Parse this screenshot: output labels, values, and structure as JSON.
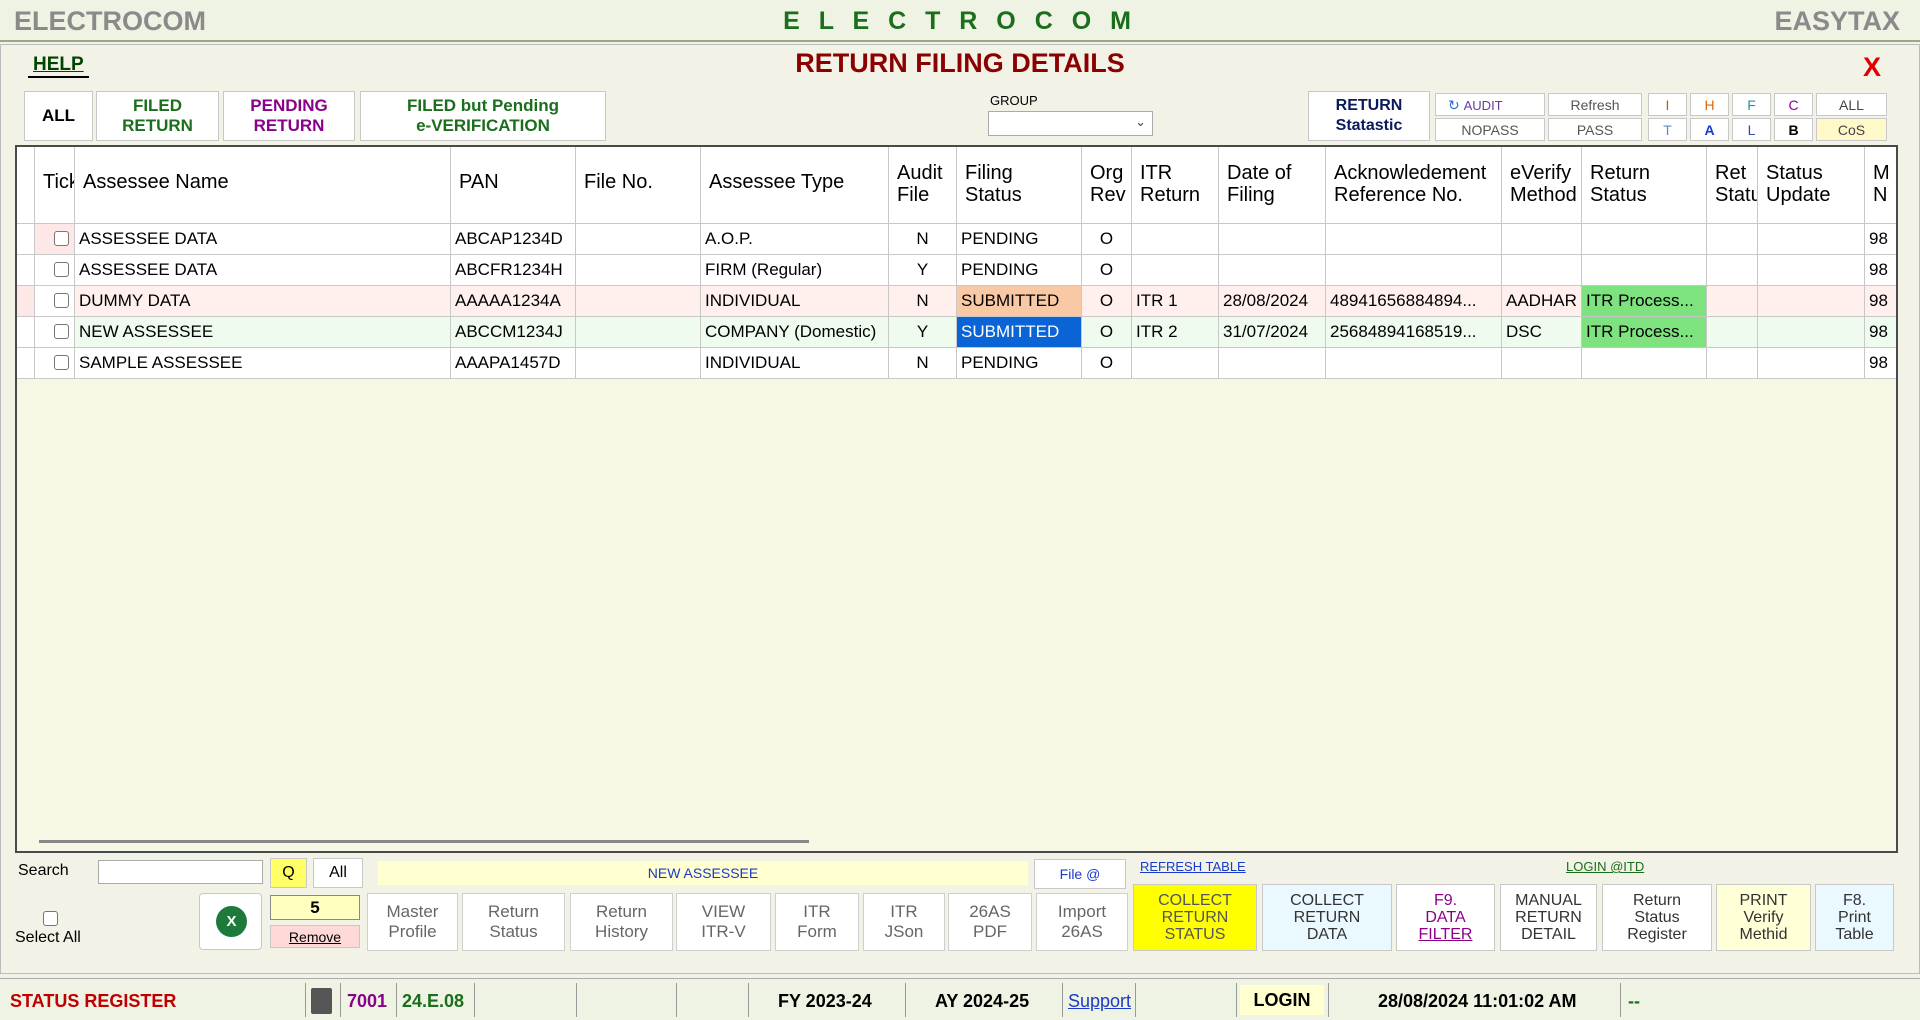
{
  "app": {
    "left_title": "ELECTROCOM",
    "center_title": "E L E C T R O C O M",
    "right_title": "EASYTAX"
  },
  "header": {
    "help": "HELP",
    "title": "RETURN FILING DETAILS",
    "close": "X"
  },
  "tabs": {
    "all": "ALL",
    "filed_1": "FILED",
    "filed_2": "RETURN",
    "pending_1": "PENDING",
    "pending_2": "RETURN",
    "fbp_1": "FILED but  Pending",
    "fbp_2": "e-VERIFICATION"
  },
  "group": {
    "label": "GROUP",
    "value": ""
  },
  "stats": {
    "return_1": "RETURN",
    "return_2": "Statastic",
    "audit": "AUDIT",
    "nopass": "NOPASS",
    "refresh": "Refresh",
    "pass": "PASS",
    "i": "I",
    "h": "H",
    "f": "F",
    "c": "C",
    "all": "ALL",
    "t": "T",
    "a": "A",
    "l": "L",
    "b": "B",
    "cos": "CoS"
  },
  "table": {
    "headers": [
      "Tick",
      "Assessee Name",
      "PAN",
      "File No.",
      "Assessee Type",
      "Audit File",
      "Filing Status",
      "Org Rev",
      "ITR Return",
      "Date of Filing",
      "Acknowledement Reference No.",
      "eVerify Method",
      "Return Status",
      "Ret Statu",
      "Status Update",
      "M N"
    ],
    "headers_l1": [
      "Tick",
      "Assessee Name",
      "PAN",
      "File No.",
      "Assessee Type",
      "Audit",
      "Filing",
      "Org",
      "ITR",
      "Date of",
      "Acknowledement",
      "eVerify",
      "Return",
      "Ret",
      "Status",
      "M"
    ],
    "headers_l2": [
      "",
      "",
      "",
      "",
      "",
      "File",
      "Status",
      "Rev",
      "Return",
      "Filing",
      "Reference No.",
      "Method",
      "Status",
      "Statu",
      "Update",
      "N"
    ],
    "rows": [
      {
        "name": "ASSESSEE DATA",
        "pan": "ABCAP1234D",
        "file": "",
        "type": "A.O.P.",
        "audit": "N",
        "status": "PENDING",
        "org": "O",
        "itr": "",
        "date": "",
        "ack": "",
        "everify": "",
        "rstatus": "",
        "ret": "",
        "update": "",
        "m": "98"
      },
      {
        "name": "ASSESSEE DATA",
        "pan": "ABCFR1234H",
        "file": "",
        "type": "FIRM (Regular)",
        "audit": "Y",
        "status": "PENDING",
        "org": "O",
        "itr": "",
        "date": "",
        "ack": "",
        "everify": "",
        "rstatus": "",
        "ret": "",
        "update": "",
        "m": "98"
      },
      {
        "name": "DUMMY DATA",
        "pan": "AAAAA1234A",
        "file": "",
        "type": "INDIVIDUAL",
        "audit": "N",
        "status": "SUBMITTED",
        "org": "O",
        "itr": "ITR 1",
        "date": "28/08/2024",
        "ack": "48941656884894...",
        "everify": "AADHAR",
        "rstatus": "ITR Process...",
        "ret": "",
        "update": "",
        "m": "98"
      },
      {
        "name": "NEW ASSESSEE",
        "pan": "ABCCM1234J",
        "file": "",
        "type": "COMPANY (Domestic)",
        "audit": "Y",
        "status": "SUBMITTED",
        "org": "O",
        "itr": "ITR 2",
        "date": "31/07/2024",
        "ack": "25684894168519...",
        "everify": "DSC",
        "rstatus": "ITR Process...",
        "ret": "",
        "update": "",
        "m": "98"
      },
      {
        "name": "SAMPLE ASSESSEE",
        "pan": "AAAPA1457D",
        "file": "",
        "type": "INDIVIDUAL",
        "audit": "N",
        "status": "PENDING",
        "org": "O",
        "itr": "",
        "date": "",
        "ack": "",
        "everify": "",
        "rstatus": "",
        "ret": "",
        "update": "",
        "m": "98"
      }
    ]
  },
  "bottom": {
    "search_label": "Search",
    "search_value": "",
    "q": "Q",
    "all": "All",
    "current": "NEW ASSESSEE",
    "file_at": "File @",
    "refresh_table": "REFRESH TABLE",
    "login_itd": "LOGIN @ITD",
    "select_all": "Select All",
    "count": "5",
    "remove": "Remove",
    "buttons": [
      {
        "l1": "Master",
        "l2": "Profile"
      },
      {
        "l1": "Return",
        "l2": "Status"
      },
      {
        "l1": "Return",
        "l2": "History"
      },
      {
        "l1": "VIEW",
        "l2": "ITR-V"
      },
      {
        "l1": "ITR",
        "l2": "Form"
      },
      {
        "l1": "ITR",
        "l2": "JSon"
      },
      {
        "l1": "26AS",
        "l2": "PDF"
      },
      {
        "l1": "Import",
        "l2": "26AS"
      }
    ],
    "collect_status": [
      "COLLECT",
      "RETURN",
      "STATUS"
    ],
    "collect_data": [
      "COLLECT",
      "RETURN",
      "DATA"
    ],
    "f9": [
      "F9.",
      "DATA",
      "FILTER"
    ],
    "manual": [
      "MANUAL",
      "RETURN",
      "DETAIL"
    ],
    "register": [
      "Return",
      "Status",
      "Register"
    ],
    "print_verify": [
      "PRINT",
      "Verify",
      "Methid"
    ],
    "f8": [
      "F8.",
      "Print",
      "Table"
    ]
  },
  "status": {
    "title": "STATUS REGISTER",
    "code": "7001",
    "version": "24.E.08",
    "fy": "FY 2023-24",
    "ay": "AY 2024-25",
    "support": "Support",
    "login": "LOGIN",
    "datetime": "28/08/2024 11:01:02 AM",
    "end": "--"
  },
  "colors": {
    "accent_green": "#1b6e1b",
    "title_red": "#8b0000",
    "submitted_orange": "#f9c9a5",
    "submitted_blue": "#0a64d6",
    "itr_green": "#7ee27e",
    "collect_yellow": "#ffff00"
  }
}
